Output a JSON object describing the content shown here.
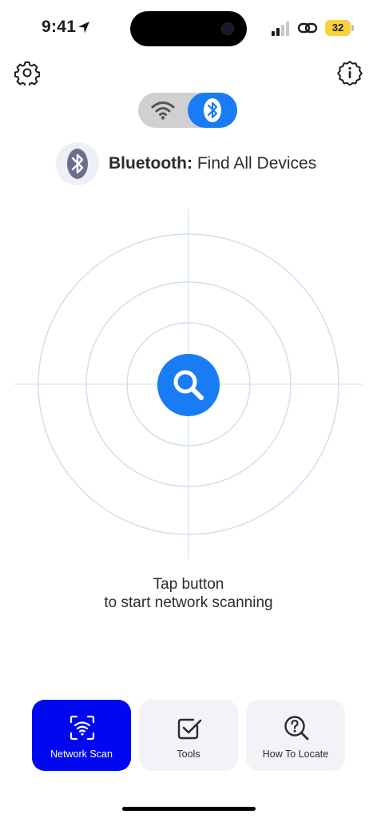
{
  "status_bar": {
    "time": "9:41",
    "battery": "32"
  },
  "header": {
    "settings_icon": "gear-icon",
    "info_icon": "info-badge-icon",
    "toggle": {
      "options": [
        "wifi",
        "bluetooth"
      ],
      "selected": "bluetooth"
    }
  },
  "mode": {
    "label": "Bluetooth:",
    "title": "Find All Devices"
  },
  "scan": {
    "button_icon": "search-icon",
    "hint_line1": "Tap button",
    "hint_line2": "to start network scanning"
  },
  "tabs": [
    {
      "label": "Network Scan",
      "icon": "network-scan-icon",
      "active": true
    },
    {
      "label": "Tools",
      "icon": "checkbox-icon",
      "active": false
    },
    {
      "label": "How To Locate",
      "icon": "question-search-icon",
      "active": false
    }
  ],
  "colors": {
    "accent": "#1a7cf5",
    "active_tab": "#0008f0",
    "radar_lines": "#cfe0f3"
  }
}
